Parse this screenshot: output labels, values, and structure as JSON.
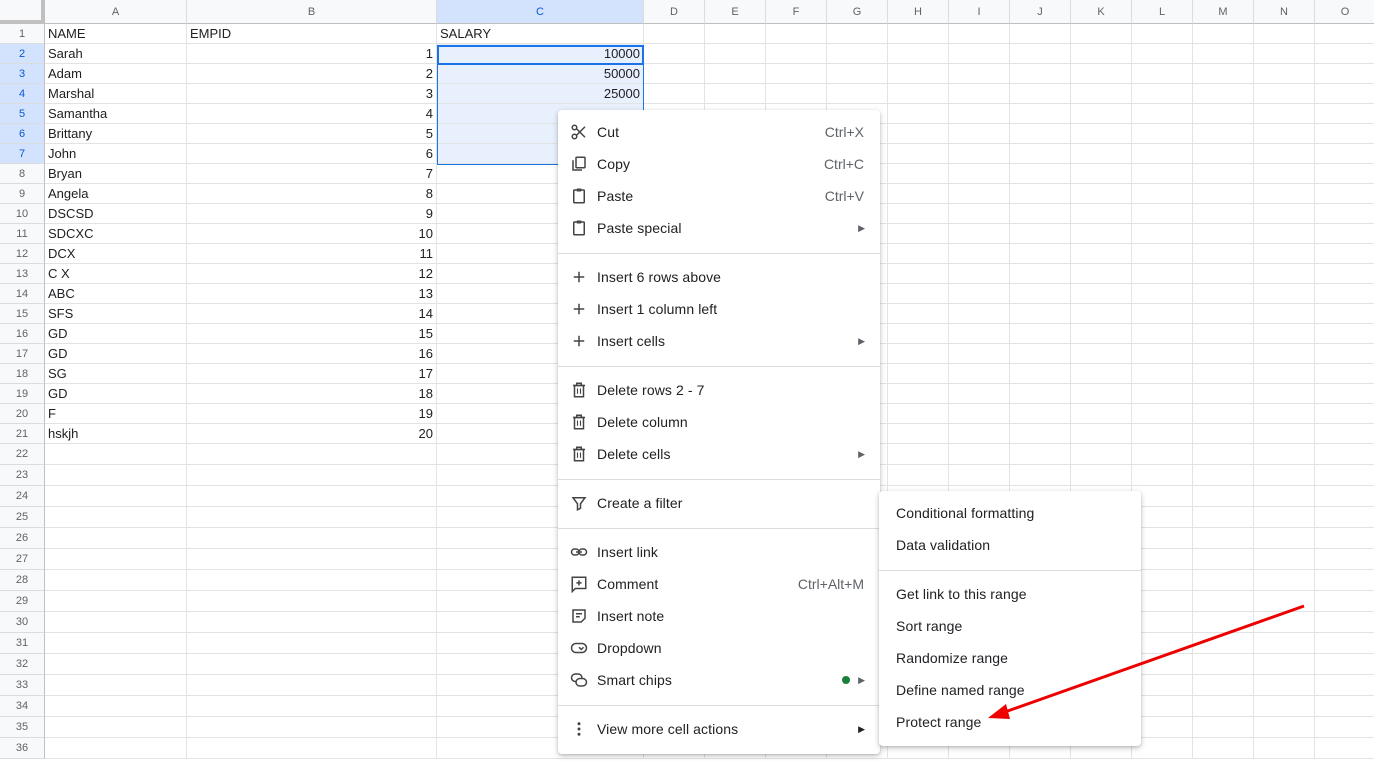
{
  "columns": [
    "A",
    "B",
    "C",
    "D",
    "E",
    "F",
    "G",
    "H",
    "I",
    "J",
    "K",
    "L",
    "M",
    "N",
    "O"
  ],
  "selected_column": "C",
  "selected_rows": [
    2,
    3,
    4,
    5,
    6,
    7
  ],
  "row_count": 36,
  "headers": {
    "A": "NAME",
    "B": "EMPID",
    "C": "SALARY"
  },
  "rows": [
    {
      "name": "Sarah",
      "empid": "1",
      "salary": "10000"
    },
    {
      "name": "Adam",
      "empid": "2",
      "salary": "50000"
    },
    {
      "name": "Marshal",
      "empid": "3",
      "salary": "25000"
    },
    {
      "name": "Samantha",
      "empid": "4",
      "salary": ""
    },
    {
      "name": "Brittany",
      "empid": "5",
      "salary": ""
    },
    {
      "name": "John",
      "empid": "6",
      "salary": ""
    },
    {
      "name": "Bryan",
      "empid": "7",
      "salary": ""
    },
    {
      "name": "Angela",
      "empid": "8",
      "salary": ""
    },
    {
      "name": "DSCSD",
      "empid": "9",
      "salary": ""
    },
    {
      "name": "SDCXC",
      "empid": "10",
      "salary": ""
    },
    {
      "name": "DCX",
      "empid": "11",
      "salary": ""
    },
    {
      "name": "C X",
      "empid": "12",
      "salary": ""
    },
    {
      "name": "ABC",
      "empid": "13",
      "salary": ""
    },
    {
      "name": "SFS",
      "empid": "14",
      "salary": ""
    },
    {
      "name": "GD",
      "empid": "15",
      "salary": ""
    },
    {
      "name": "GD",
      "empid": "16",
      "salary": ""
    },
    {
      "name": "SG",
      "empid": "17",
      "salary": ""
    },
    {
      "name": "GD",
      "empid": "18",
      "salary": ""
    },
    {
      "name": "F",
      "empid": "19",
      "salary": ""
    },
    {
      "name": "hskjh",
      "empid": "20",
      "salary": ""
    }
  ],
  "context_menu": {
    "cut": {
      "label": "Cut",
      "shortcut": "Ctrl+X"
    },
    "copy": {
      "label": "Copy",
      "shortcut": "Ctrl+C"
    },
    "paste": {
      "label": "Paste",
      "shortcut": "Ctrl+V"
    },
    "paste_special": {
      "label": "Paste special"
    },
    "insert_rows": {
      "label": "Insert 6 rows above"
    },
    "insert_column": {
      "label": "Insert 1 column left"
    },
    "insert_cells": {
      "label": "Insert cells"
    },
    "delete_rows": {
      "label": "Delete rows 2 - 7"
    },
    "delete_column": {
      "label": "Delete column"
    },
    "delete_cells": {
      "label": "Delete cells"
    },
    "create_filter": {
      "label": "Create a filter"
    },
    "insert_link": {
      "label": "Insert link"
    },
    "comment": {
      "label": "Comment",
      "shortcut": "Ctrl+Alt+M"
    },
    "insert_note": {
      "label": "Insert note"
    },
    "dropdown": {
      "label": "Dropdown"
    },
    "smart_chips": {
      "label": "Smart chips"
    },
    "view_more": {
      "label": "View more cell actions"
    }
  },
  "more_menu": {
    "conditional_formatting": "Conditional formatting",
    "data_validation": "Data validation",
    "get_link": "Get link to this range",
    "sort_range": "Sort range",
    "randomize_range": "Randomize range",
    "define_named_range": "Define named range",
    "protect_range": "Protect range"
  },
  "colors": {
    "selection": "#1a73e8",
    "highlight": "#e00000",
    "smart_chip_dot": "#188038"
  }
}
